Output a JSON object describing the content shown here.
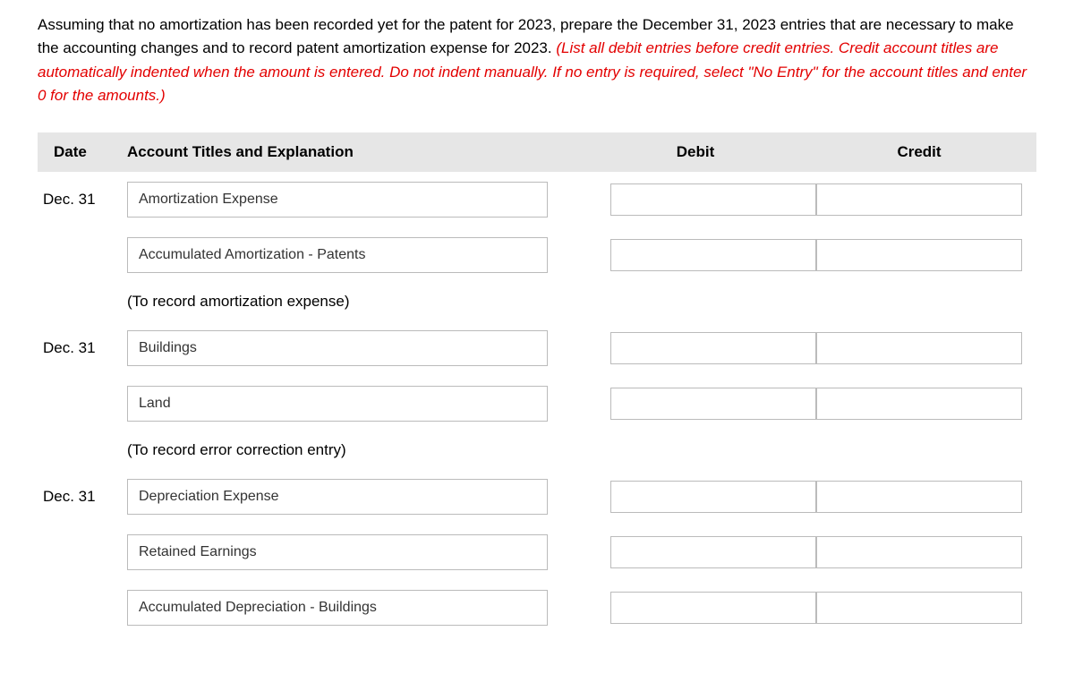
{
  "instructions": {
    "part1": "Assuming that no amortization has been recorded yet for the patent for 2023, prepare the December 31, 2023 entries that are necessary to make the accounting changes and to record patent amortization expense for 2023. ",
    "part2": "(List all debit entries before credit entries. Credit account titles are automatically indented when the amount is entered. Do not indent manually. If no entry is required, select \"No Entry\" for the account titles and enter 0 for the amounts.)"
  },
  "headers": {
    "date": "Date",
    "account": "Account Titles and Explanation",
    "debit": "Debit",
    "credit": "Credit"
  },
  "rows": [
    {
      "date": "Dec. 31",
      "account": "Amortization Expense",
      "debit": "",
      "credit": ""
    },
    {
      "date": "",
      "account": "Accumulated Amortization - Patents",
      "debit": "",
      "credit": ""
    }
  ],
  "description1": "(To record amortization expense)",
  "rows2": [
    {
      "date": "Dec. 31",
      "account": "Buildings",
      "debit": "",
      "credit": ""
    },
    {
      "date": "",
      "account": "Land",
      "debit": "",
      "credit": ""
    }
  ],
  "description2": "(To record error correction entry)",
  "rows3": [
    {
      "date": "Dec. 31",
      "account": "Depreciation Expense",
      "debit": "",
      "credit": ""
    },
    {
      "date": "",
      "account": "Retained Earnings",
      "debit": "",
      "credit": ""
    },
    {
      "date": "",
      "account": "Accumulated Depreciation - Buildings",
      "debit": "",
      "credit": ""
    }
  ]
}
